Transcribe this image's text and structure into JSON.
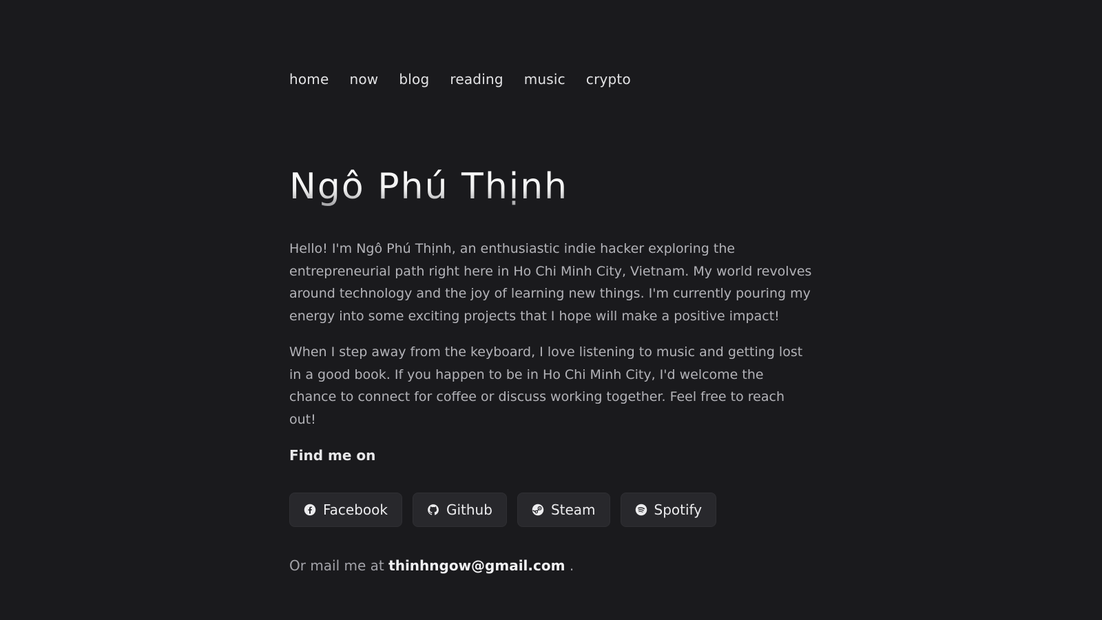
{
  "nav": {
    "items": [
      {
        "label": "home"
      },
      {
        "label": "now"
      },
      {
        "label": "blog"
      },
      {
        "label": "reading"
      },
      {
        "label": "music"
      },
      {
        "label": "crypto"
      }
    ]
  },
  "profile": {
    "name": "Ngô Phú Thịnh",
    "bio_1": "Hello! I'm Ngô Phú Thịnh, an enthusiastic indie hacker exploring the entrepreneurial path right here in Ho Chi Minh City, Vietnam. My world revolves around technology and the joy of learning new things. I'm currently pouring my energy into some exciting projects that I hope will make a positive impact!",
    "bio_2": "When I step away from the keyboard, I love listening to music and getting lost in a good book. If you happen to be in Ho Chi Minh City, I'd welcome the chance to connect for coffee or discuss working together. Feel free to reach out!"
  },
  "social": {
    "heading": "Find me on",
    "links": [
      {
        "label": "Facebook",
        "icon": "facebook-icon"
      },
      {
        "label": "Github",
        "icon": "github-icon"
      },
      {
        "label": "Steam",
        "icon": "steam-icon"
      },
      {
        "label": "Spotify",
        "icon": "spotify-icon"
      }
    ]
  },
  "contact": {
    "prefix": "Or mail me at",
    "email": "thinhngow@gmail.com",
    "suffix": "."
  },
  "colors": {
    "background": "#1a1a1d",
    "button_bg": "#28282c",
    "text_muted": "#b3b3b8",
    "text_bright": "#ececee"
  }
}
